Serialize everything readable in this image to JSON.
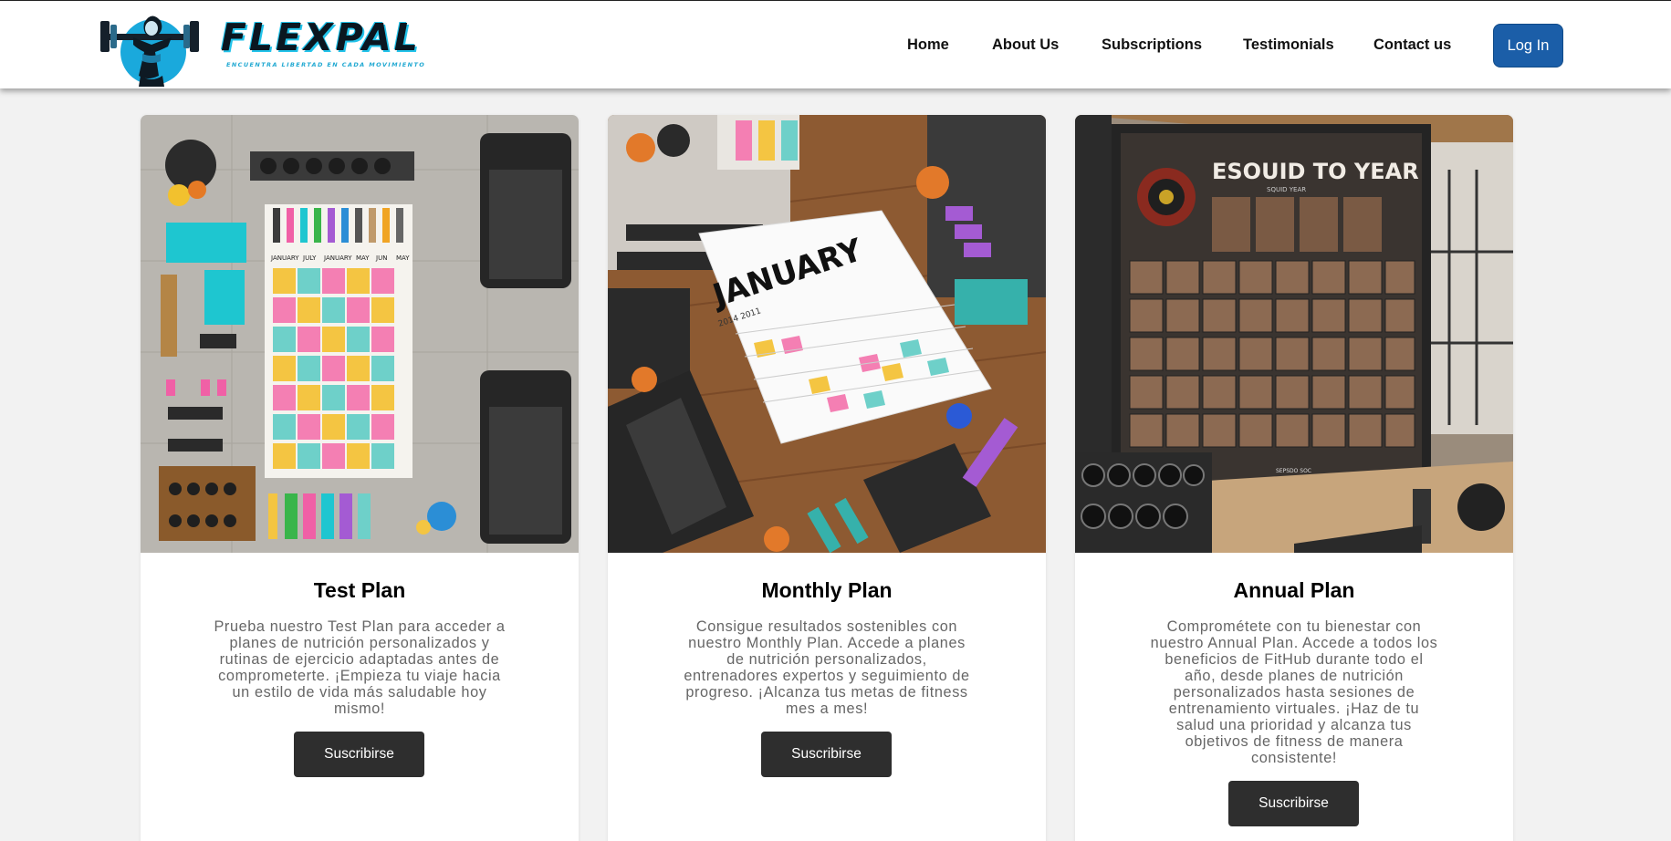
{
  "header": {
    "brand": "FLEXPAL",
    "tagline": "ENCUENTRA LIBERTAD EN CADA MOVIMIENTO",
    "nav": [
      {
        "label": "Home"
      },
      {
        "label": "About Us"
      },
      {
        "label": "Subscriptions"
      },
      {
        "label": "Testimonials"
      },
      {
        "label": "Contact us"
      }
    ],
    "login_label": "Log In"
  },
  "plans": [
    {
      "title": "Test Plan",
      "description": "Prueba nuestro Test Plan para acceder a planes de nutrición personalizados y rutinas de ejercicio adaptadas antes de comprometerte. ¡Empieza tu viaje hacia un estilo de vida más saludable hoy mismo!",
      "button": "Suscribirse",
      "image_labels": [
        "JANUARY",
        "JULY",
        "JANUARY",
        "MAY",
        "JUN",
        "MAY"
      ]
    },
    {
      "title": "Monthly Plan",
      "description": "Consigue resultados sostenibles con nuestro Monthly Plan. Accede a planes de nutrición personalizados, entrenadores expertos y seguimiento de progreso. ¡Alcanza tus metas de fitness mes a mes!",
      "button": "Suscribirse",
      "image_labels": [
        "JANUARY",
        "2014 2011"
      ]
    },
    {
      "title": "Annual Plan",
      "description": "Comprométete con tu bienestar con nuestro Annual Plan. Accede a todos los beneficios de FitHub durante todo el año, desde planes de nutrición personalizados hasta sesiones de entrenamiento virtuales. ¡Haz de tu salud una prioridad y alcanza tus objetivos de fitness de manera consistente!",
      "button": "Suscribirse",
      "image_labels": [
        "ESOUID TO YEAR",
        "SQUID YEAR",
        "SEPSDO SOC"
      ]
    }
  ],
  "colors": {
    "header_bg": "#ffffff",
    "page_bg": "#f2f2f2",
    "login_bg": "#1b5ea8",
    "button_bg": "#2e2e2e",
    "brand_accent": "#22c3ea"
  },
  "icons": {
    "logo_emblem": "athlete-with-dumbbell-icon"
  }
}
